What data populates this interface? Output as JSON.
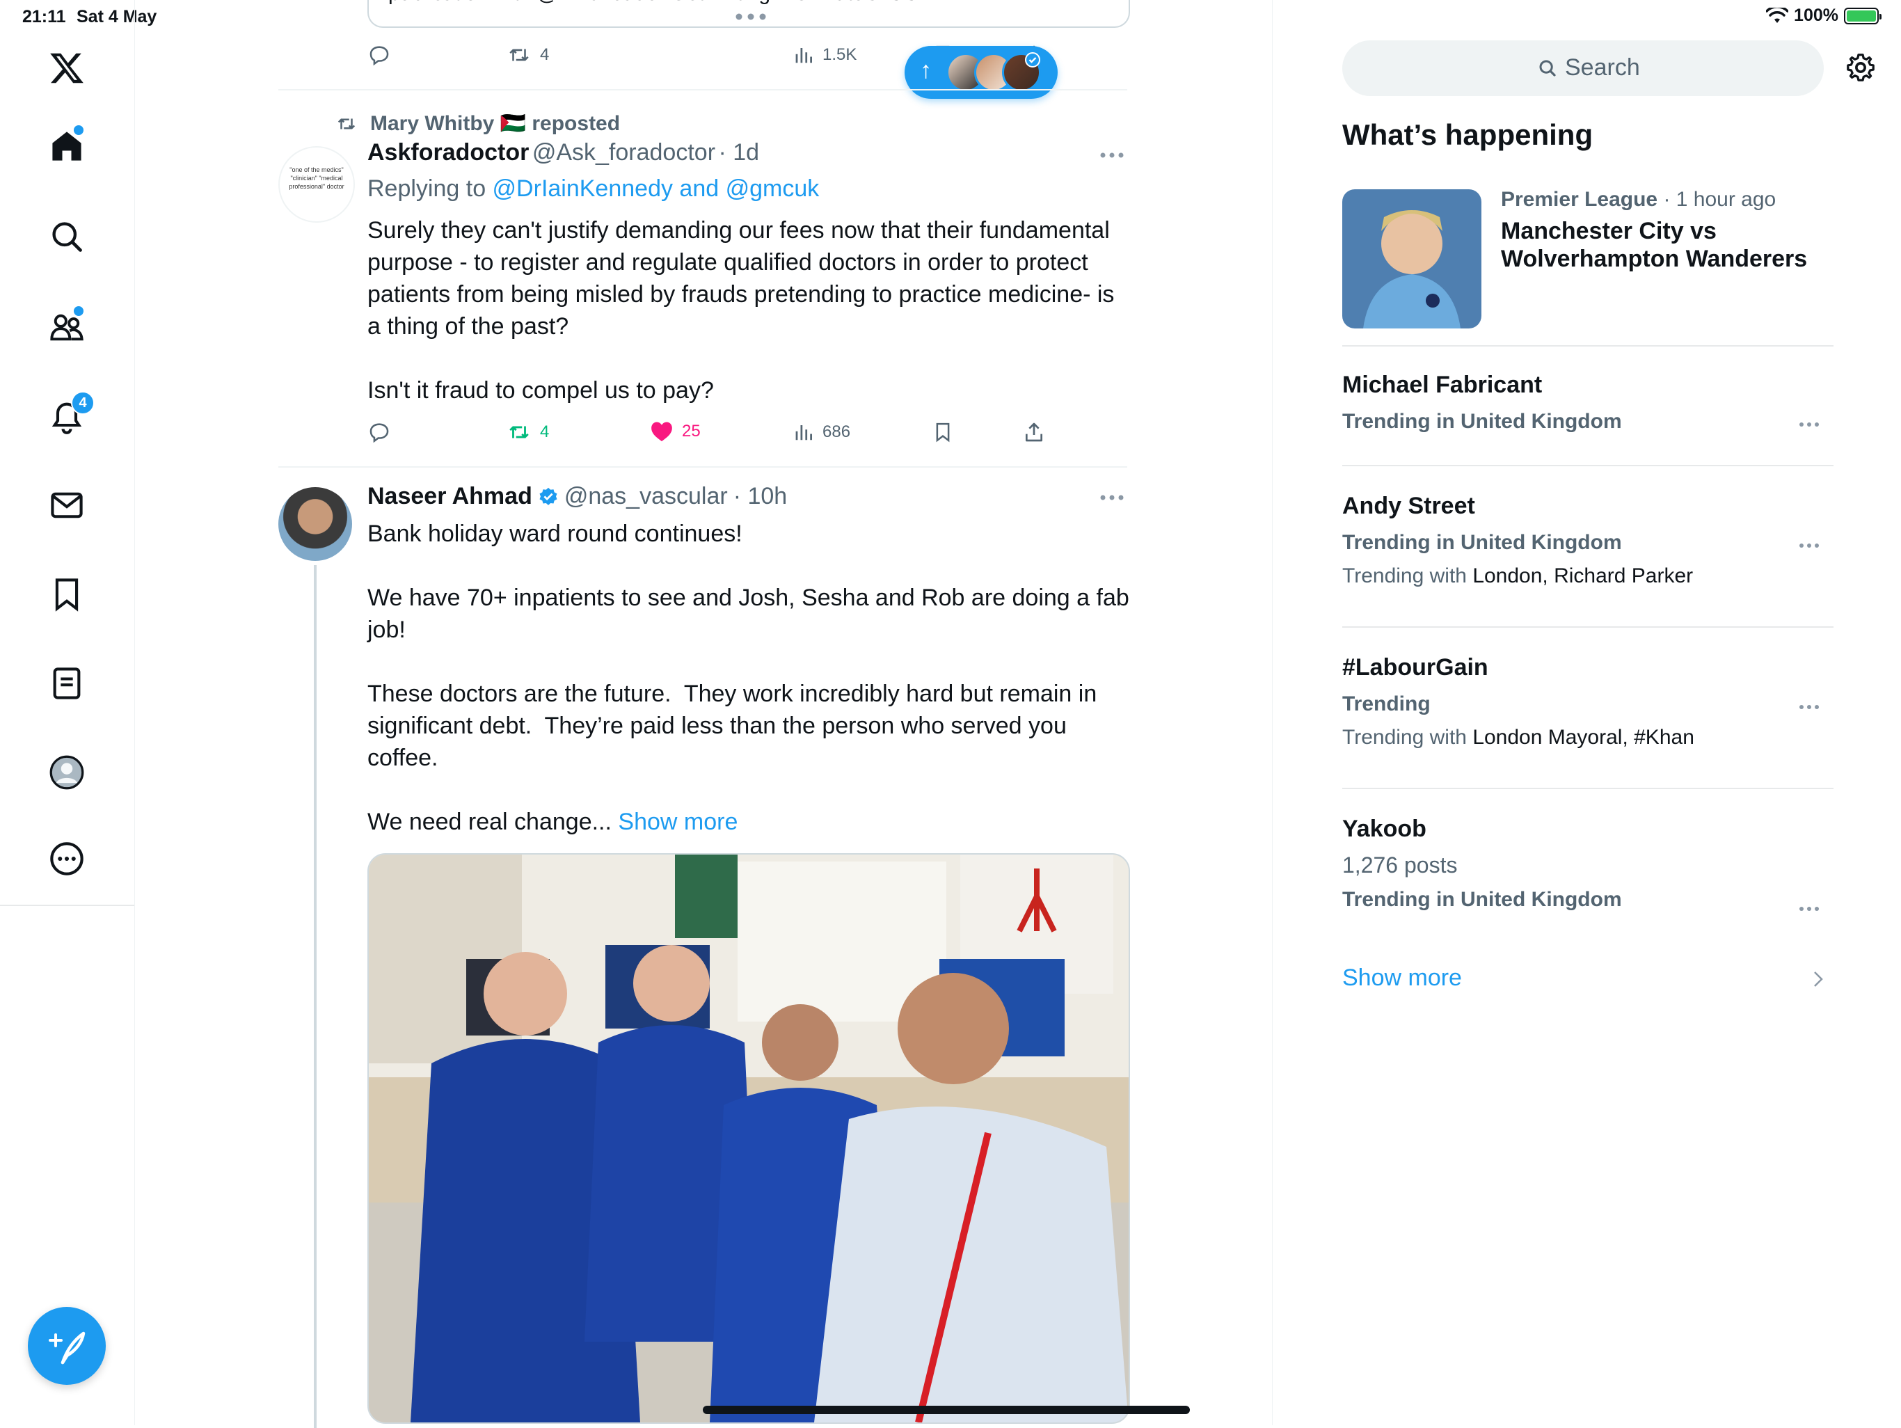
{
  "status_bar": {
    "time": "21:11",
    "date": "Sat 4 May",
    "battery": "100%"
  },
  "sidebar": {
    "notifications_badge": "4"
  },
  "new_posts_pill": {
    "arrow": "↑"
  },
  "top_tweet": {
    "partial_text": "publication with @BMJLeader Get writing! #ClimateCrisis ...",
    "retweets": "4",
    "views": "1.5K"
  },
  "tweet1": {
    "repost_by": "Mary Whitby 🇵🇸 reposted",
    "author": "Askforadoctor",
    "handle": "@Ask_foradoctor",
    "time": "· 1d",
    "avatar_text": "\"one of the medics\" \"clinician\" \"medical professional\" doctor",
    "replying_prefix": "Replying to ",
    "replying_to": "@DrIainKennedy and @gmcuk",
    "text": "Surely they can't justify demanding our fees now that their fundamental purpose - to register and regulate qualified doctors in order to protect patients from being misled by frauds pretending to practice medicine- is a thing of the past?\n\nIsn't it fraud to compel us to pay?",
    "retweets": "4",
    "likes": "25",
    "views": "686"
  },
  "tweet2": {
    "author": "Naseer Ahmad",
    "handle": "@nas_vascular",
    "time": "· 10h",
    "text": "Bank holiday ward round continues!\n\nWe have 70+ inpatients to see and Josh, Sesha and Rob are doing a fab job!\n\nThese doctors are the future.  They work incredibly hard but remain in significant debt.  They’re paid less than the person who served you coffee.\n\nWe need real change...",
    "show_more": "Show more"
  },
  "right": {
    "search_placeholder": "Search",
    "heading": "What’s happening",
    "featured": {
      "category": "Premier League",
      "time": " · 1 hour ago",
      "title": "Manchester City vs Wolverhampton Wanderers"
    },
    "trends": [
      {
        "title": "Michael Fabricant",
        "context": "Trending in United Kingdom"
      },
      {
        "title": "Andy Street",
        "context": "Trending in United Kingdom",
        "with_label": "Trending with ",
        "with": "London, Richard Parker"
      },
      {
        "title": "#LabourGain",
        "context": "Trending",
        "with_label": "Trending with ",
        "with": "London Mayoral, #Khan"
      },
      {
        "title": "Yakoob",
        "posts": "1,276 posts",
        "context": "Trending in United Kingdom"
      }
    ],
    "show_more": "Show more"
  },
  "colors": {
    "accent": "#1d9bf0",
    "like": "#f91880",
    "retweet": "#00ba7c",
    "muted": "#536471"
  }
}
